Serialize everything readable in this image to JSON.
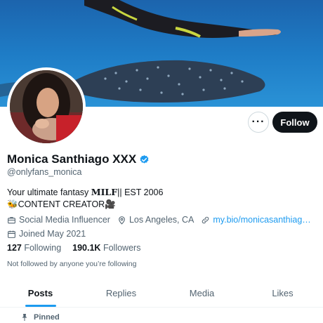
{
  "profile": {
    "display_name": "Monica Santhiago XXX",
    "handle": "@onlyfans_monica",
    "bio_line1_prefix": "Your ultimate fantasy ",
    "bio_line1_styled": "𝐌𝐈𝐋𝐅",
    "bio_line1_suffix": "|| EST 2006",
    "bio_line2_emoji_start": "🐝",
    "bio_line2_text": "CONTENT CREATOR",
    "bio_line2_emoji_end": "🎥",
    "category": "Social Media Influencer",
    "location": "Los Angeles, CA",
    "link": "my.bio/monicasanthiag…",
    "joined": "Joined May 2021"
  },
  "stats": {
    "following_count": "127",
    "following_label": "Following",
    "followers_count": "190.1K",
    "followers_label": "Followers"
  },
  "not_followed_text": "Not followed by anyone you’re following",
  "actions": {
    "more_label": "···",
    "follow_label": "Follow"
  },
  "tabs": [
    {
      "label": "Posts",
      "active": true
    },
    {
      "label": "Replies",
      "active": false
    },
    {
      "label": "Media",
      "active": false
    },
    {
      "label": "Likes",
      "active": false
    }
  ],
  "pinned_label": "Pinned",
  "colors": {
    "accent": "#1d9bf0",
    "text_primary": "#0f1419",
    "text_secondary": "#536471",
    "follow_button_bg": "#0f1419"
  },
  "icons": {
    "verified": "verified-badge-icon",
    "category": "briefcase-icon",
    "location": "location-pin-icon",
    "link": "link-icon",
    "joined": "calendar-icon",
    "pinned": "pin-icon"
  }
}
